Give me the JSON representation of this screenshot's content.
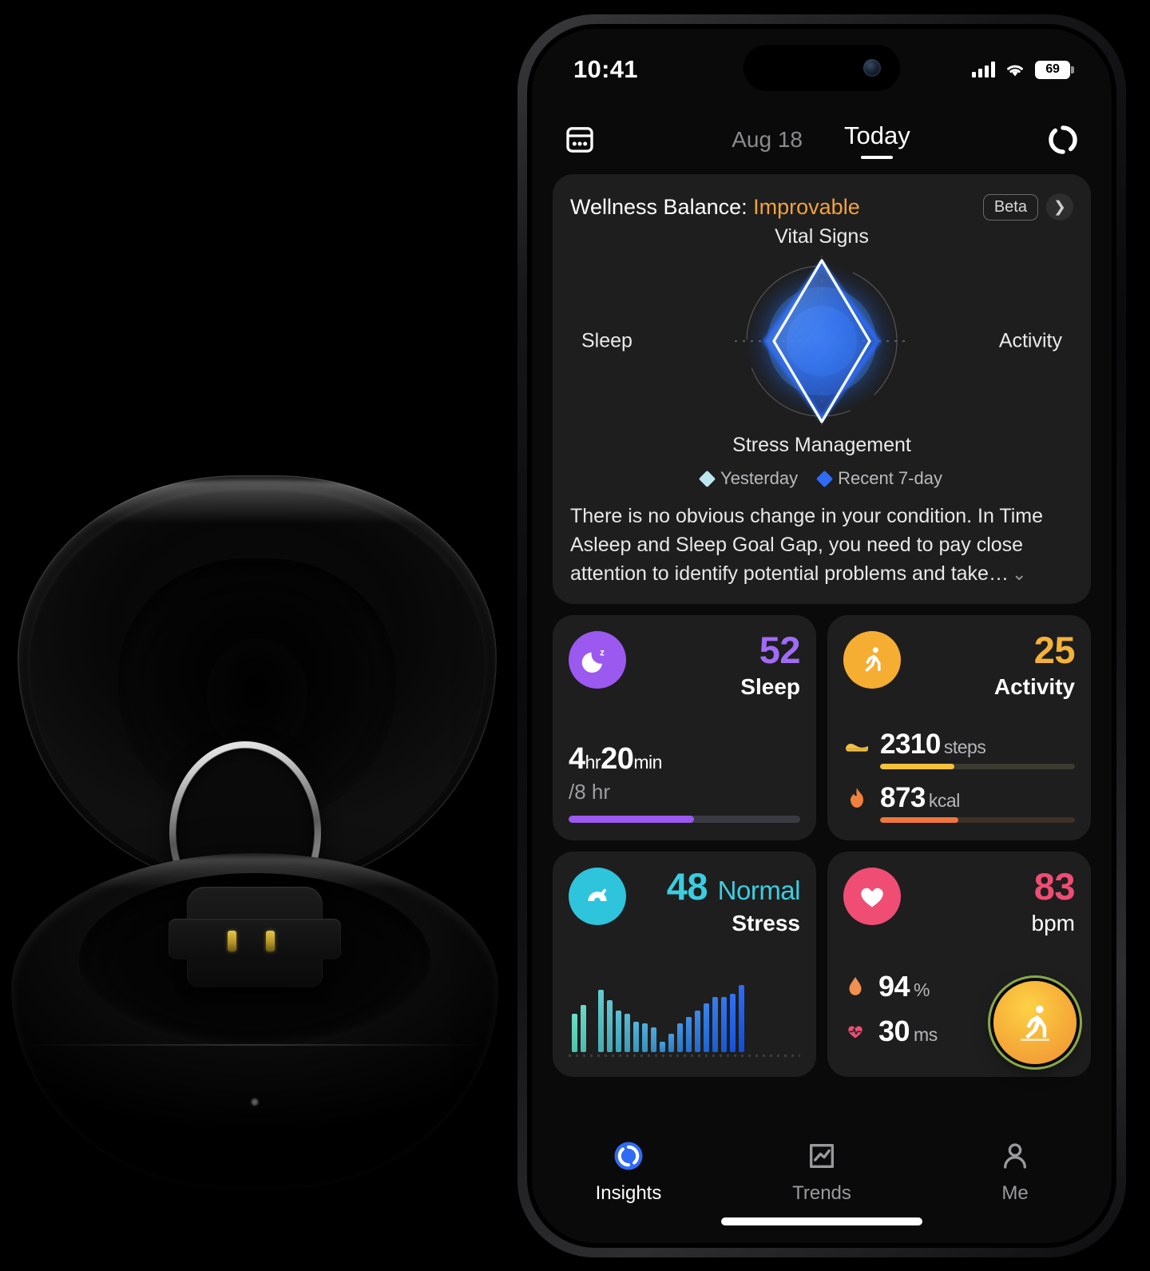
{
  "status_bar": {
    "time": "10:41",
    "battery_percent": "69",
    "signal_icon": "cellular-signal-icon",
    "wifi_icon": "wifi-icon"
  },
  "navbar": {
    "calendar_icon": "calendar-icon",
    "prev_date": "Aug 18",
    "current_tab": "Today",
    "sync_icon": "ring-sync-icon"
  },
  "wellness": {
    "title_prefix": "Wellness Balance:",
    "status": "Improvable",
    "status_color": "#f2a33c",
    "beta_badge": "Beta",
    "chevron_icon": "chevron-right-icon",
    "description": "There is no obvious change in your condition. In Time Asleep and Sleep Goal Gap, you need to pay close attention to identify potential problems and take…",
    "expand_icon": "chevron-down-icon"
  },
  "chart_data": {
    "type": "radar",
    "title": "Wellness Balance",
    "categories": [
      "Vital Signs",
      "Activity",
      "Stress Management",
      "Sleep"
    ],
    "series": [
      {
        "name": "Yesterday",
        "color": "#bfe6f0",
        "values": [
          92,
          42,
          88,
          40
        ]
      },
      {
        "name": "Recent 7-day",
        "color": "#2f6bf5",
        "values": [
          85,
          50,
          82,
          48
        ]
      }
    ],
    "rmax": 100,
    "grid": true,
    "legend_position": "bottom"
  },
  "metrics": {
    "sleep": {
      "icon": "sleep-moon-icon",
      "icon_color": "#9b59f0",
      "score": "52",
      "label": "Sleep",
      "score_color": "#a06bf5",
      "duration_hours": "4",
      "duration_hours_unit": "hr",
      "duration_minutes": "20",
      "duration_minutes_unit": "min",
      "goal": "/8 hr",
      "progress_percent": 54,
      "bar_color": "#9b59f0"
    },
    "activity": {
      "icon": "running-person-icon",
      "icon_color": "#f5ad32",
      "score": "25",
      "label": "Activity",
      "score_color": "#f5b23a",
      "steps_icon": "shoe-icon",
      "steps_value": "2310",
      "steps_unit": "steps",
      "steps_percent": 38,
      "steps_bar_color": "#f5c23a",
      "kcal_icon": "flame-icon",
      "kcal_value": "873",
      "kcal_unit": "kcal",
      "kcal_percent": 40,
      "kcal_bar_color": "#f0763c"
    },
    "stress": {
      "icon": "stress-gauge-icon",
      "icon_color": "#2ec4dc",
      "score": "48",
      "state": "Normal",
      "label": "Stress",
      "score_color": "#3ccde0",
      "bars": [
        46,
        56,
        0,
        74,
        62,
        50,
        46,
        36,
        34,
        30,
        12,
        22,
        34,
        42,
        50,
        58,
        66,
        66,
        70,
        80
      ]
    },
    "heart": {
      "icon": "heart-icon",
      "icon_color": "#ef4d74",
      "value": "83",
      "unit": "bpm",
      "value_color": "#ef4d74",
      "spo2_icon": "blood-drop-icon",
      "spo2_value": "94",
      "spo2_unit": "%",
      "hrv_icon": "heart-pulse-icon",
      "hrv_value": "30",
      "hrv_unit": "ms",
      "fab_icon": "running-person-icon"
    }
  },
  "tabbar": {
    "items": [
      {
        "label": "Insights",
        "icon": "ring-insights-icon",
        "active": true
      },
      {
        "label": "Trends",
        "icon": "trends-chart-icon",
        "active": false
      },
      {
        "label": "Me",
        "icon": "person-icon",
        "active": false
      }
    ]
  }
}
